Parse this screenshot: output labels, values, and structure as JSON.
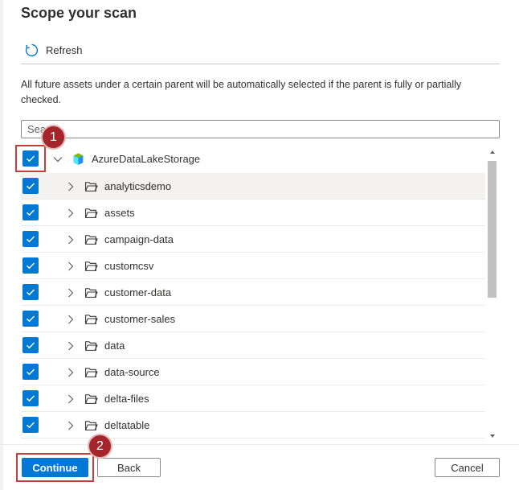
{
  "title": "Scope your scan",
  "toolbar": {
    "refresh_label": "Refresh"
  },
  "info_text": "All future assets under a certain parent will be automatically selected if the parent is fully or partially checked.",
  "search": {
    "placeholder": "Search"
  },
  "tree": {
    "root": {
      "label": "AzureDataLakeStorage",
      "checked": true,
      "expanded": true,
      "icon": "storage-account-icon"
    },
    "children": [
      {
        "label": "analyticsdemo",
        "checked": true
      },
      {
        "label": "assets",
        "checked": true
      },
      {
        "label": "campaign-data",
        "checked": true
      },
      {
        "label": "customcsv",
        "checked": true
      },
      {
        "label": "customer-data",
        "checked": true
      },
      {
        "label": "customer-sales",
        "checked": true
      },
      {
        "label": "data",
        "checked": true
      },
      {
        "label": "data-source",
        "checked": true
      },
      {
        "label": "delta-files",
        "checked": true
      },
      {
        "label": "deltatable",
        "checked": true
      }
    ]
  },
  "footer": {
    "continue_label": "Continue",
    "back_label": "Back",
    "cancel_label": "Cancel"
  },
  "callouts": [
    {
      "number": "1"
    },
    {
      "number": "2"
    }
  ],
  "colors": {
    "accent": "#0078d4",
    "callout": "#a4262c",
    "callout_border": "#c43e3e"
  }
}
